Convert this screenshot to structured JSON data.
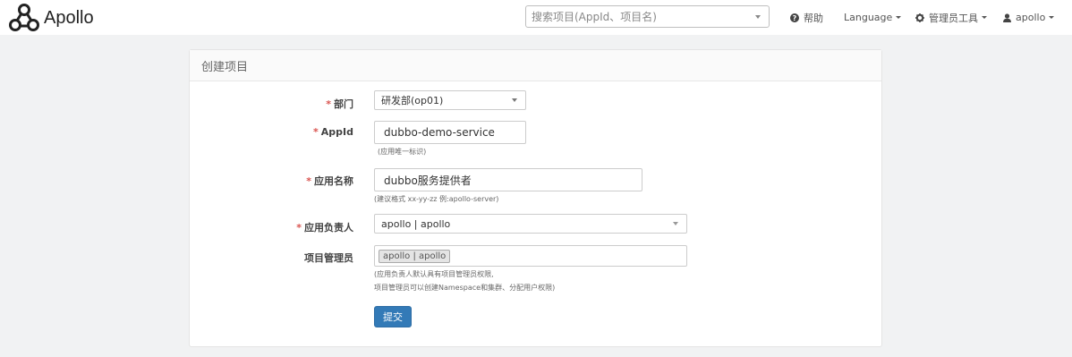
{
  "brand": {
    "name": "Apollo",
    "logo": "apollo-logo-icon"
  },
  "search": {
    "placeholder": "搜索项目(AppId、项目名)"
  },
  "nav": {
    "help": "帮助",
    "language": "Language",
    "admin_tools": "管理员工具",
    "user": "apollo"
  },
  "panel": {
    "title": "创建项目",
    "fields": {
      "department": {
        "label": "部门",
        "required": true,
        "value": "研发部(op01)"
      },
      "appid": {
        "label": "AppId",
        "required": true,
        "value": "dubbo-demo-service",
        "help": "(应用唯一标识)"
      },
      "app_name": {
        "label": "应用名称",
        "required": true,
        "value": "dubbo服务提供者",
        "help": "(建议格式 xx-yy-zz 例:apollo-server)"
      },
      "owner": {
        "label": "应用负责人",
        "required": true,
        "value": "apollo | apollo"
      },
      "admins": {
        "label": "项目管理员",
        "tags": [
          "apollo | apollo"
        ],
        "help_line1": "(应用负责人默认具有项目管理员权限,",
        "help_line2": "项目管理员可以创建Namespace和集群、分配用户权限)"
      }
    },
    "submit": "提交"
  },
  "colors": {
    "primary": "#337ab7",
    "required": "#d9534f"
  }
}
